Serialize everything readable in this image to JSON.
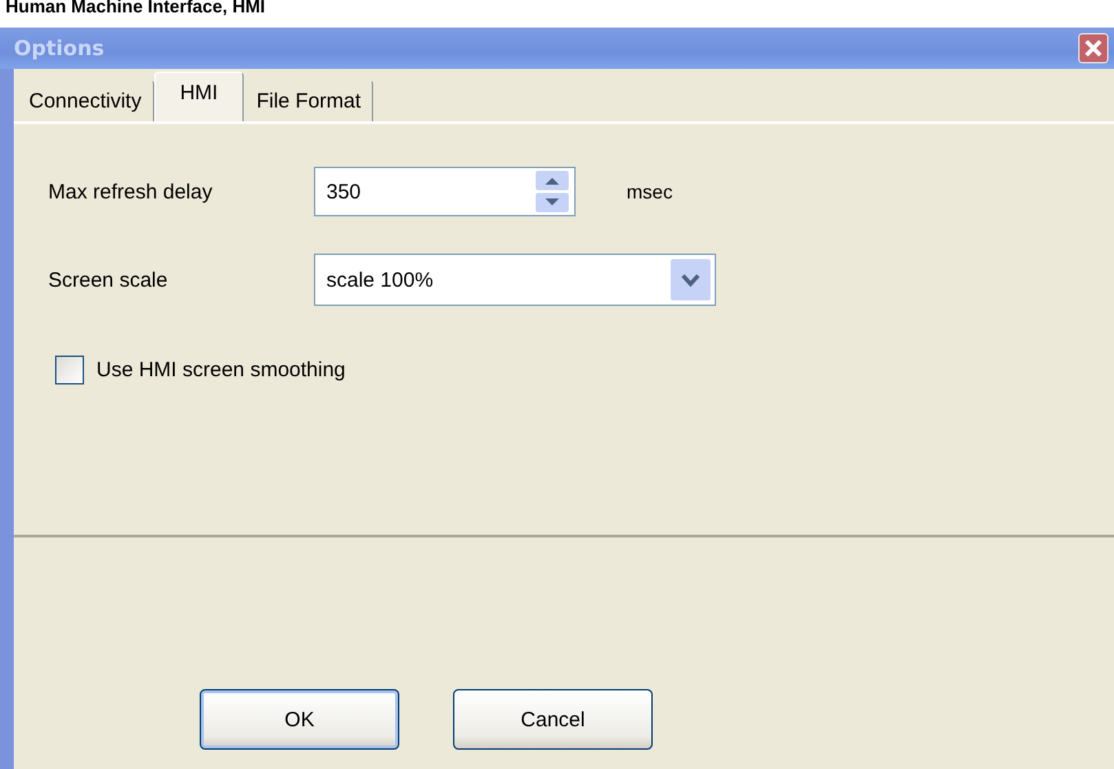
{
  "heading": "Human Machine Interface, HMI",
  "window": {
    "title": "Options"
  },
  "tabs": [
    {
      "label": "Connectivity",
      "selected": false
    },
    {
      "label": "HMI",
      "selected": true
    },
    {
      "label": "File Format",
      "selected": false
    }
  ],
  "refresh": {
    "label": "Max refresh delay",
    "value": "350",
    "unit": "msec"
  },
  "scale": {
    "label": "Screen scale",
    "value": "scale 100%"
  },
  "smoothing": {
    "label": "Use HMI screen smoothing",
    "checked": false
  },
  "buttons": [
    {
      "label": "OK",
      "default": true
    },
    {
      "label": "Cancel",
      "default": false
    }
  ]
}
